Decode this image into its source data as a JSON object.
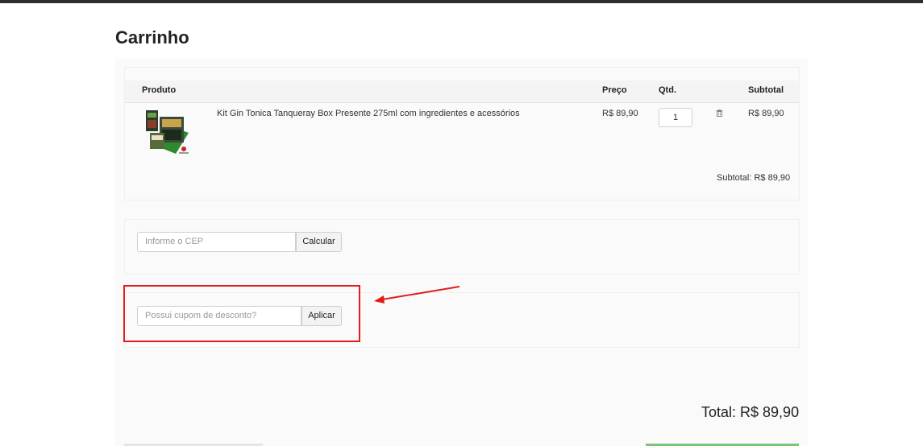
{
  "colors": {
    "highlight": "#e21c1c",
    "checkout_button": "#7bc47a"
  },
  "page_title": "Carrinho",
  "cart": {
    "headers": {
      "product": "Produto",
      "price": "Preço",
      "qty": "Qtd.",
      "subtotal": "Subtotal"
    },
    "item": {
      "image_icon": "product-image",
      "name": "Kit Gin Tonica Tanqueray Box Presente 275ml com ingredientes e acessórios",
      "price": "R$ 89,90",
      "qty": "1",
      "subtotal": "R$ 89,90",
      "remove_icon": "trash-icon"
    },
    "subtotal_line": "Subtotal: R$ 89,90"
  },
  "shipping": {
    "placeholder": "Informe o CEP",
    "button": "Calcular"
  },
  "coupon": {
    "placeholder": "Possui cupom de desconto?",
    "button": "Aplicar"
  },
  "total": "Total: R$ 89,90"
}
